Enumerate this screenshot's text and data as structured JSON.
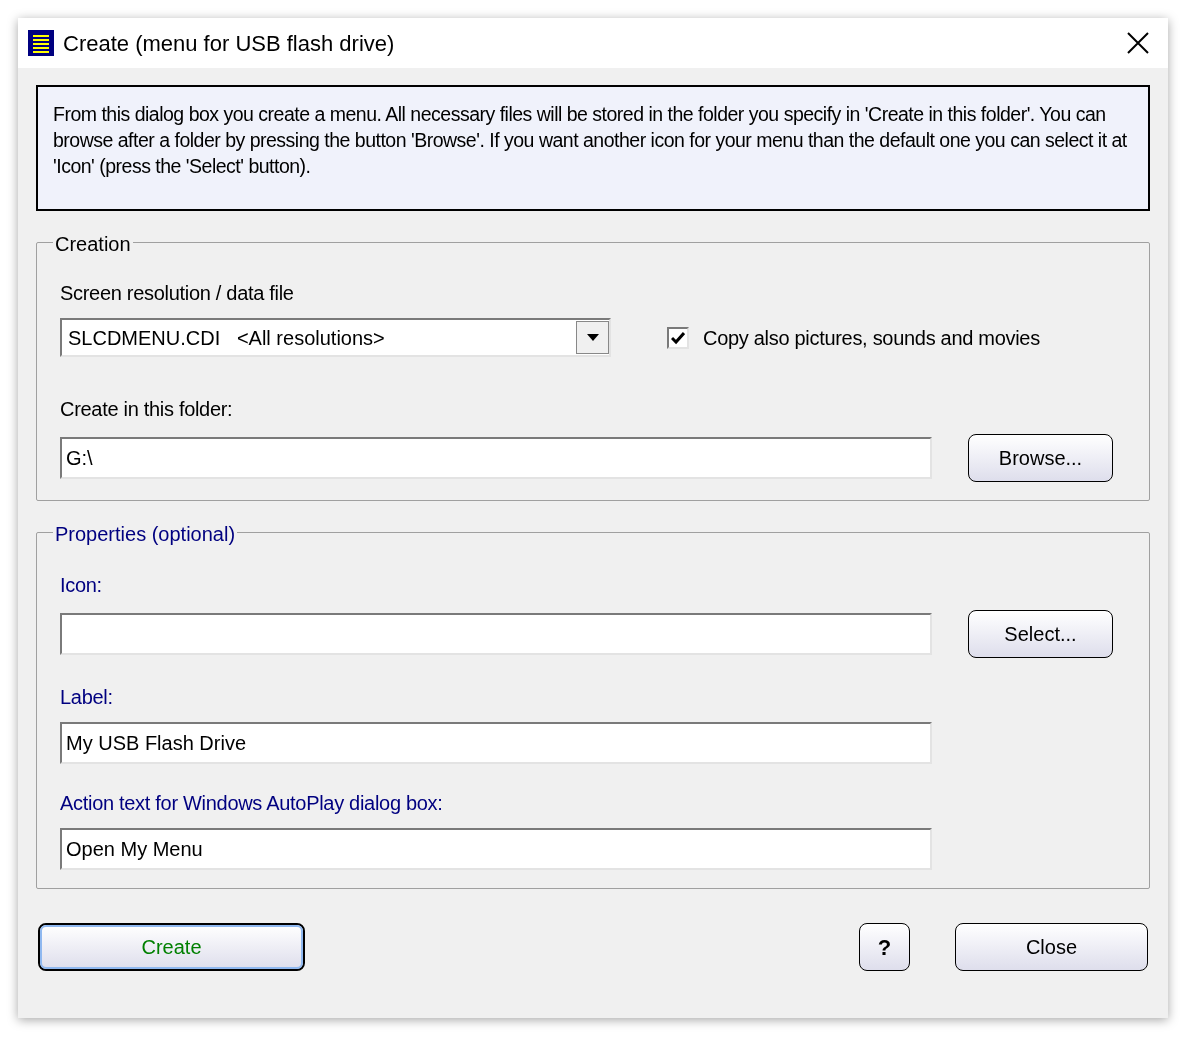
{
  "window": {
    "title": "Create (menu for USB flash drive)"
  },
  "info_text": "From this dialog box you create a menu. All necessary files will be stored in the folder you specify in 'Create in this folder'. You can browse after a folder by pressing the button 'Browse'. If you want another icon for your menu than the default one you can select it at 'Icon' (press the 'Select' button).",
  "groups": [
    {
      "title": "Creation",
      "kind": "required",
      "fields": [
        {
          "kind": "combo",
          "label": "Screen resolution / data file",
          "value": "SLCDMENU.CDI   <All resolutions>",
          "checkbox": {
            "label": "Copy also pictures, sounds and movies",
            "checked": true
          }
        },
        {
          "kind": "text",
          "label": "Create in this folder:",
          "value": "G:\\",
          "button": "Browse..."
        }
      ]
    },
    {
      "title": "Properties (optional)",
      "kind": "optional",
      "fields": [
        {
          "kind": "text",
          "label": "Icon:",
          "button": "Select..."
        },
        {
          "kind": "text",
          "label": "Label:",
          "value": "My USB Flash Drive"
        },
        {
          "kind": "text",
          "label": "Action text for Windows AutoPlay dialog box:",
          "value": "Open My Menu"
        }
      ]
    }
  ],
  "buttons": [
    {
      "label": "Create",
      "kind": "default"
    },
    {
      "label": "?",
      "kind": "help"
    },
    {
      "label": "Close",
      "kind": "normal"
    }
  ]
}
